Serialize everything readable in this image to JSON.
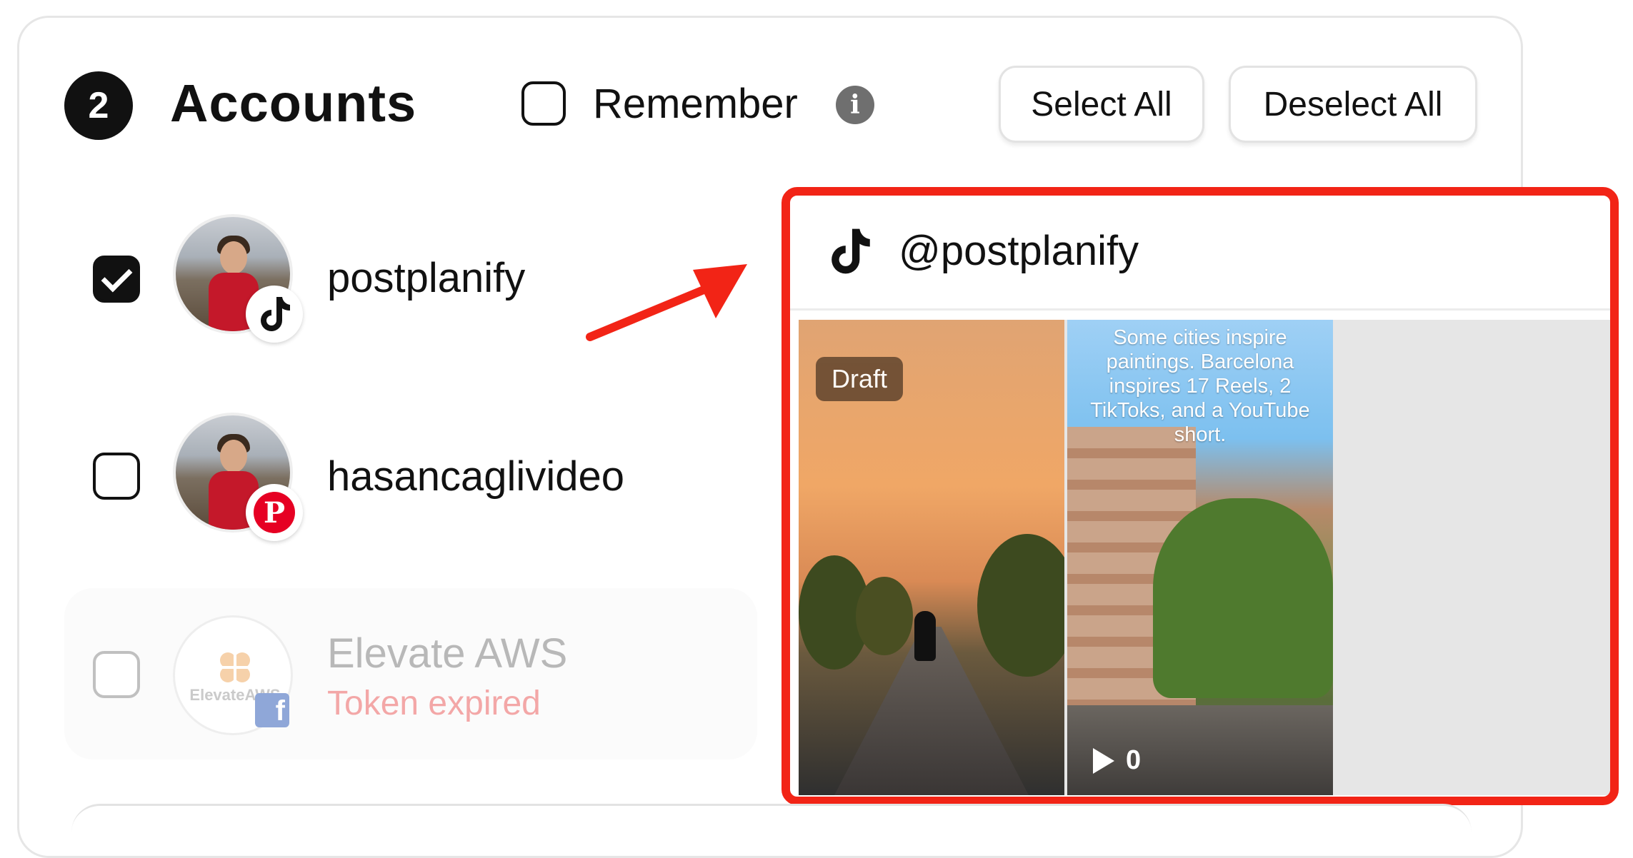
{
  "header": {
    "step_number": "2",
    "title": "Accounts",
    "remember_label": "Remember",
    "info_icon": "info-icon",
    "select_all_label": "Select All",
    "deselect_all_label": "Deselect All"
  },
  "accounts": [
    {
      "name": "postplanify",
      "platform": "tiktok",
      "checked": true,
      "status": ""
    },
    {
      "name": "hasancaglivideo",
      "platform": "pinterest",
      "checked": false,
      "status": ""
    },
    {
      "name": "Elevate AWS",
      "platform": "facebook",
      "checked": false,
      "status": "Token expired",
      "avatar_text": "ElevateAWS"
    }
  ],
  "preview": {
    "handle": "@postplanify",
    "platform_icon": "tiktok-icon",
    "thumbnails": [
      {
        "badge": "Draft"
      },
      {
        "overlay_text": "Some cities inspire paintings. Barcelona inspires 17 Reels, 2 TikToks, and a YouTube short.",
        "views": "0"
      }
    ]
  },
  "colors": {
    "highlight": "#f22416",
    "status_error": "#f3a3a3",
    "pinterest": "#e60023",
    "facebook": "#8aa3d6"
  }
}
